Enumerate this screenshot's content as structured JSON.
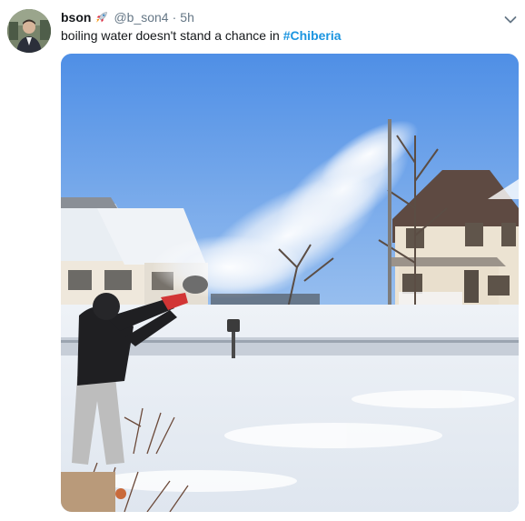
{
  "tweet": {
    "display_name": "bson",
    "name_emoji": "rocket-emoji",
    "handle": "@b_son4",
    "separator": "·",
    "timestamp": "5h",
    "text_before_hashtag": "boiling water doesn't stand a chance in ",
    "hashtag": "#Chiberia"
  },
  "icons": {
    "avatar": "profile-photo",
    "caret": "chevron-down-icon"
  },
  "colors": {
    "link": "#1b95e0",
    "secondary_text": "#657786",
    "primary_text": "#14171a"
  }
}
